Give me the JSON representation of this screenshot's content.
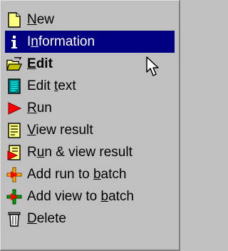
{
  "menu": {
    "items": [
      {
        "label": "New",
        "ul": 0,
        "icon": "new-document-icon",
        "selected": false,
        "bold": false
      },
      {
        "label": "Information",
        "ul": 1,
        "icon": "information-icon",
        "selected": true,
        "bold": false
      },
      {
        "label": "Edit",
        "ul": 0,
        "icon": "open-folder-edit-icon",
        "selected": false,
        "bold": true
      },
      {
        "label": "Edit text",
        "ul": 5,
        "icon": "text-document-icon",
        "selected": false,
        "bold": false
      },
      {
        "label": "Run",
        "ul": 0,
        "icon": "run-arrow-icon",
        "selected": false,
        "bold": false
      },
      {
        "label": "View result",
        "ul": 0,
        "icon": "result-document-icon",
        "selected": false,
        "bold": false
      },
      {
        "label": "Run & view result",
        "ul": 1,
        "icon": "run-view-result-icon",
        "selected": false,
        "bold": false
      },
      {
        "label": "Add run to batch",
        "ul": 11,
        "icon": "add-run-batch-icon",
        "selected": false,
        "bold": false
      },
      {
        "label": "Add view to batch",
        "ul": 12,
        "icon": "add-view-batch-icon",
        "selected": false,
        "bold": false
      },
      {
        "label": "Delete",
        "ul": 0,
        "icon": "trash-can-icon",
        "selected": false,
        "bold": false
      }
    ]
  },
  "colors": {
    "menu_bg": "#c0c0c0",
    "selection_bg": "#000080",
    "selection_text": "#ffffff"
  }
}
